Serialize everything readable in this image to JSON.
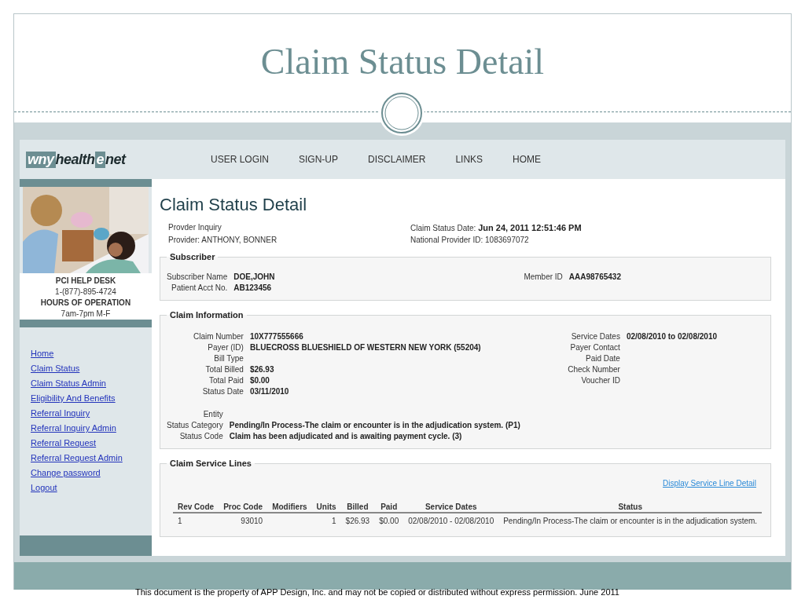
{
  "slide": {
    "title": "Claim Status Detail",
    "footer": "This document is the property of APP Design, Inc. and may not be copied or distributed without express permission.  June 2011"
  },
  "site": {
    "logo": [
      "wny",
      "health",
      "e",
      "net"
    ],
    "nav": [
      "USER LOGIN",
      "SIGN-UP",
      "DISCLAIMER",
      "LINKS",
      "HOME"
    ],
    "sidebar": {
      "help_desk": [
        {
          "text": "PCI HELP DESK",
          "kind": "heading"
        },
        {
          "text": "1-(877)-895-4724",
          "kind": "plain"
        },
        {
          "text": "HOURS OF OPERATION",
          "kind": "heading"
        },
        {
          "text": "7am-7pm M-F",
          "kind": "plain"
        }
      ],
      "links": [
        "Home",
        "Claim Status",
        "Claim Status Admin",
        "Eligibility And Benefits",
        "Referral Inquiry",
        "Referral Inquiry Admin",
        "Referral Request",
        "Referral Request Admin",
        "Change password",
        "Logout"
      ]
    },
    "page_title": "Claim Status Detail",
    "header_left": [
      "Provder Inquiry",
      "Provider: ANTHONY, BONNER"
    ],
    "header_right": [
      {
        "label": "Claim Status Date:",
        "value": "Jun 24, 2011 12:51:46 PM",
        "kind": "bold"
      },
      {
        "label": "National Provider ID:",
        "value": "1083697072",
        "kind": "plain"
      }
    ],
    "subscriber": {
      "legend": "Subscriber",
      "left": [
        {
          "label": "Subscriber Name",
          "value": "DOE,JOHN"
        },
        {
          "label": "Patient Acct No.",
          "value": "AB123456"
        }
      ],
      "right": [
        {
          "label": "Member ID",
          "value": "AAA98765432"
        }
      ]
    },
    "claim_information": {
      "legend": "Claim Information",
      "left": [
        {
          "label": "Claim Number",
          "value": "10X777555666"
        },
        {
          "label": "Payer (ID)",
          "value": "BLUECROSS BLUESHIELD OF WESTERN NEW YORK (55204)"
        },
        {
          "label": "Bill Type"
        },
        {
          "label": "Total Billed",
          "value": "$26.93"
        },
        {
          "label": "Total Paid",
          "value": "$0.00"
        },
        {
          "label": "Status Date",
          "value": "03/11/2010"
        }
      ],
      "right": [
        {
          "label": "Service Dates",
          "value": "02/08/2010 to 02/08/2010"
        },
        {
          "label": "Payer Contact"
        },
        {
          "label": "Paid Date"
        },
        {
          "label": "Check Number"
        },
        {
          "label": "Voucher ID"
        }
      ],
      "status": [
        {
          "label": "Entity"
        },
        {
          "label": "Status Category",
          "value": "Pending/In Process-The claim or encounter is in the adjudication system. (P1)"
        },
        {
          "label": "Status Code",
          "value": "Claim has been adjudicated and is awaiting payment cycle. (3)"
        }
      ]
    },
    "claim_service_lines": {
      "legend": "Claim Service Lines",
      "link": "Display Service Line Detail",
      "columns": [
        "Rev Code",
        "Proc Code",
        "Modifiers",
        "Units",
        "Billed",
        "Paid",
        "Service Dates",
        "Status"
      ],
      "rows": [
        [
          "1",
          "93010",
          "",
          "1",
          "$26.93",
          "$0.00",
          "02/08/2010 - 02/08/2010",
          "Pending/In Process-The claim or encounter is in the adjudication system."
        ]
      ]
    }
  }
}
